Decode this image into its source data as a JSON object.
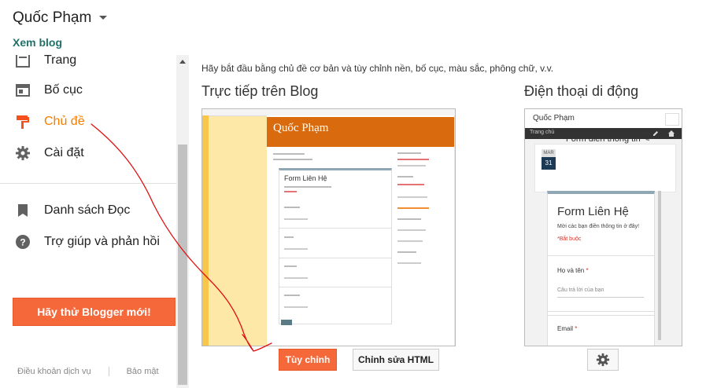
{
  "header": {
    "blog_title": "Quốc Phạm",
    "view_blog": "Xem blog"
  },
  "sidebar": {
    "items": [
      {
        "label": "Trang",
        "icon": "pages-icon"
      },
      {
        "label": "Bố cục",
        "icon": "layout-icon"
      },
      {
        "label": "Chủ đề",
        "icon": "paint-roller-icon",
        "active": true
      },
      {
        "label": "Cài đặt",
        "icon": "gear-icon"
      },
      {
        "label": "Danh sách Đọc",
        "icon": "bookmark-icon"
      },
      {
        "label": "Trợ giúp và phản hồi",
        "icon": "help-icon"
      }
    ],
    "cta": "Hãy thử Blogger mới!",
    "footer": [
      "Điều khoản dịch vụ",
      "Bảo mật"
    ]
  },
  "main": {
    "description": "Hãy bắt đầu bằng chủ đề cơ bản và tùy chỉnh nền, bố cục, màu sắc, phông chữ, v.v.",
    "live_heading": "Trực tiếp trên Blog",
    "mobile_heading": "Điện thoại di động",
    "customize_button": "Tùy chỉnh",
    "edit_html_button": "Chỉnh sửa HTML"
  },
  "desktop_preview": {
    "blog_header": "Quốc Phạm",
    "form_title": "Form Liên Hệ"
  },
  "mobile_preview": {
    "title": "Quốc Phạm",
    "nav_home": "Trang chủ",
    "date_month": "MAR",
    "date_day": "31",
    "post_title": "Form điền thông tin",
    "form_title": "Form Liên Hệ",
    "form_subtitle": "Mời các bạn điền thông tin ở đây!",
    "required_note": "*Bắt buộc",
    "field_name_label": "Họ và tên",
    "field_name_placeholder": "Câu trả lời của bạn",
    "field_email_label": "Email"
  },
  "colors": {
    "accent": "#f57d00",
    "cta": "#f4683a",
    "link": "#20716a"
  }
}
